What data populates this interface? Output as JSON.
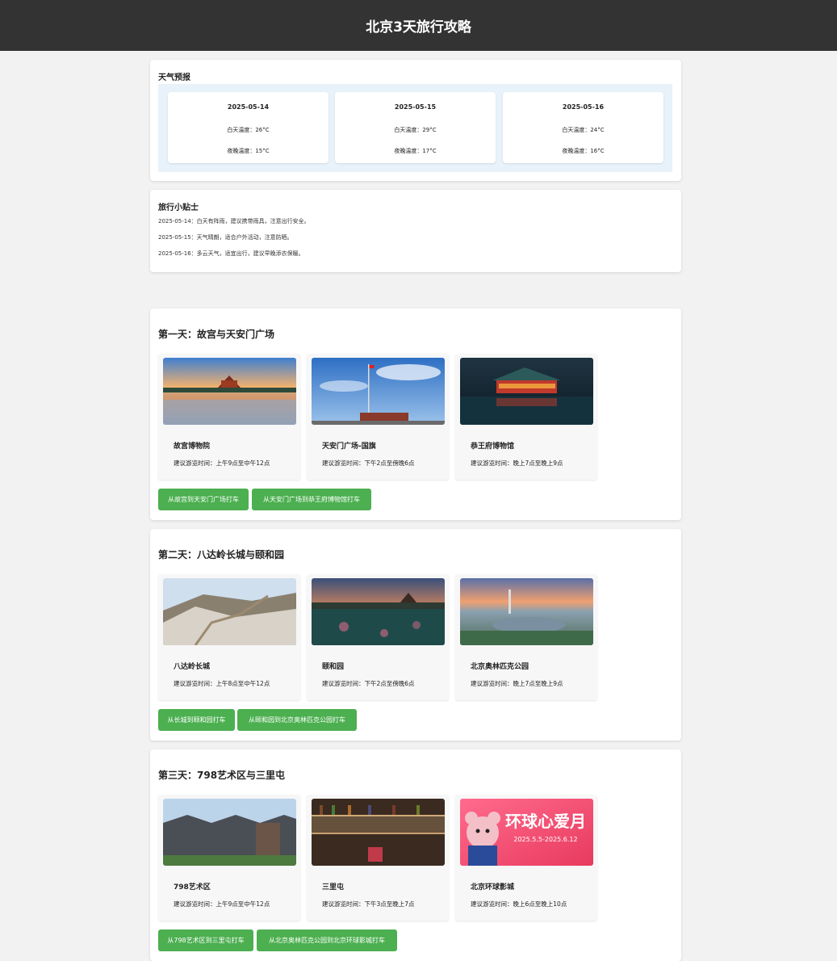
{
  "page_title": "北京3天旅行攻略",
  "weather": {
    "title": "天气预报",
    "days": [
      {
        "date": "2025-05-14",
        "day_temp": "白天温度：26°C",
        "night_temp": "夜晚温度：15°C"
      },
      {
        "date": "2025-05-15",
        "day_temp": "白天温度：29°C",
        "night_temp": "夜晚温度：17°C"
      },
      {
        "date": "2025-05-16",
        "day_temp": "白天温度：24°C",
        "night_temp": "夜晚温度：16°C"
      }
    ]
  },
  "tips": {
    "title": "旅行小贴士",
    "items": [
      "2025-05-14：白天有阵雨，建议携带雨具，注意出行安全。",
      "2025-05-15：天气晴朗，适合户外活动，注意防晒。",
      "2025-05-16：多云天气，适宜出行，建议早晚添衣保暖。"
    ]
  },
  "days": [
    {
      "title": "第一天：故宫与天安门广场",
      "spots": [
        {
          "name": "故宫博物院",
          "time": "建议游览时间：上午9点至中午12点"
        },
        {
          "name": "天安门广场-国旗",
          "time": "建议游览时间：下午2点至傍晚6点"
        },
        {
          "name": "恭王府博物馆",
          "time": "建议游览时间：晚上7点至晚上9点"
        }
      ],
      "buttons": [
        "从故宫到天安门广场打车",
        "从天安门广场到恭王府博物馆打车"
      ]
    },
    {
      "title": "第二天：八达岭长城与颐和园",
      "spots": [
        {
          "name": "八达岭长城",
          "time": "建议游览时间：上午8点至中午12点"
        },
        {
          "name": "颐和园",
          "time": "建议游览时间：下午2点至傍晚6点"
        },
        {
          "name": "北京奥林匹克公园",
          "time": "建议游览时间：晚上7点至晚上9点"
        }
      ],
      "buttons": [
        "从长城到颐和园打车",
        "从颐和园到北京奥林匹克公园打车"
      ]
    },
    {
      "title": "第三天：798艺术区与三里屯",
      "spots": [
        {
          "name": "798艺术区",
          "time": "建议游览时间：上午9点至中午12点"
        },
        {
          "name": "三里屯",
          "time": "建议游览时间：下午3点至晚上7点"
        },
        {
          "name": "北京环球影城",
          "time": "建议游览时间：晚上6点至晚上10点"
        }
      ],
      "buttons": [
        "从798艺术区到三里屯打车",
        "从北京奥林匹克公园到北京环球影城打车"
      ]
    }
  ],
  "poster": {
    "headline": "环球心爱月",
    "dates": "2025.5.5-2025.6.12"
  }
}
